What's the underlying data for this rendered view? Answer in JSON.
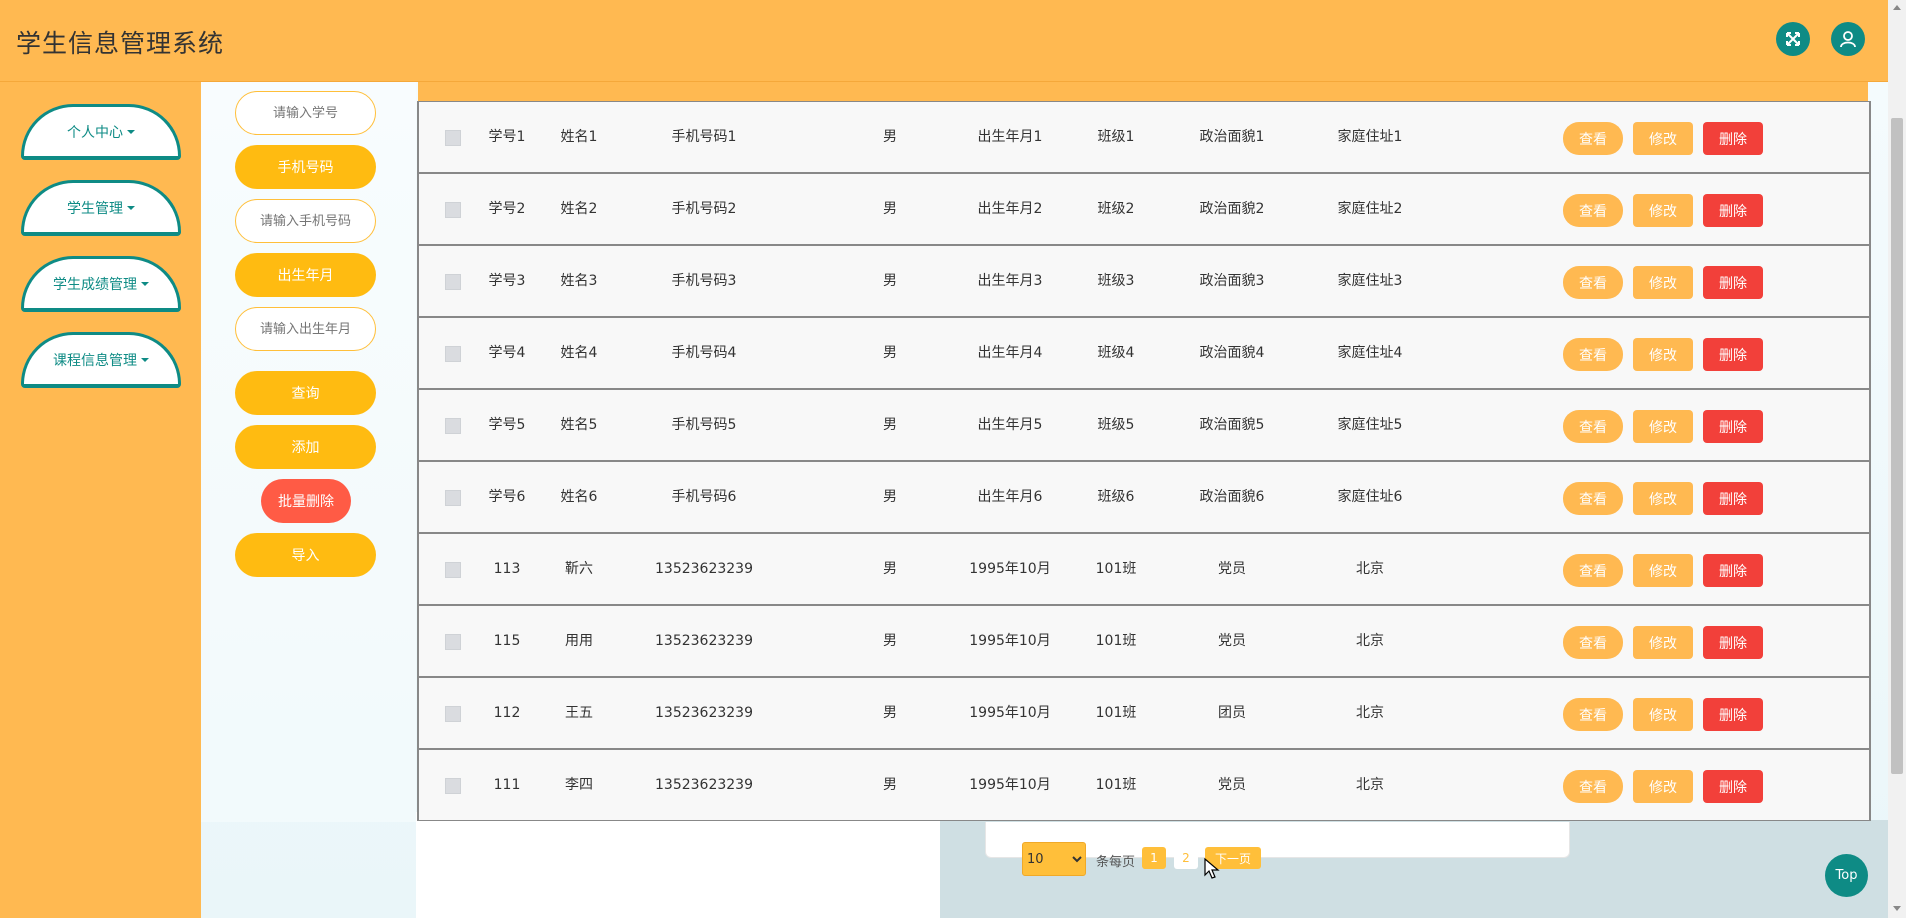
{
  "header": {
    "title": "学生信息管理系统"
  },
  "sidebar": {
    "items": [
      {
        "label": "个人中心"
      },
      {
        "label": "学生管理"
      },
      {
        "label": "学生成绩管理"
      },
      {
        "label": "课程信息管理"
      }
    ]
  },
  "filters": {
    "xuehao_placeholder": "请输入学号",
    "phone_label": "手机号码",
    "phone_placeholder": "请输入手机号码",
    "birth_label": "出生年月",
    "birth_placeholder": "请输入出生年月",
    "query_label": "查询",
    "add_label": "添加",
    "batch_delete_label": "批量删除",
    "import_label": "导入"
  },
  "table": {
    "actions": {
      "view": "查看",
      "edit": "修改",
      "delete": "删除"
    },
    "rows": [
      {
        "xuehao": "学号1",
        "name": "姓名1",
        "phone": "手机号码1",
        "gender": "男",
        "birth": "出生年月1",
        "class": "班级1",
        "politics": "政治面貌1",
        "address": "家庭住址1"
      },
      {
        "xuehao": "学号2",
        "name": "姓名2",
        "phone": "手机号码2",
        "gender": "男",
        "birth": "出生年月2",
        "class": "班级2",
        "politics": "政治面貌2",
        "address": "家庭住址2"
      },
      {
        "xuehao": "学号3",
        "name": "姓名3",
        "phone": "手机号码3",
        "gender": "男",
        "birth": "出生年月3",
        "class": "班级3",
        "politics": "政治面貌3",
        "address": "家庭住址3"
      },
      {
        "xuehao": "学号4",
        "name": "姓名4",
        "phone": "手机号码4",
        "gender": "男",
        "birth": "出生年月4",
        "class": "班级4",
        "politics": "政治面貌4",
        "address": "家庭住址4"
      },
      {
        "xuehao": "学号5",
        "name": "姓名5",
        "phone": "手机号码5",
        "gender": "男",
        "birth": "出生年月5",
        "class": "班级5",
        "politics": "政治面貌5",
        "address": "家庭住址5"
      },
      {
        "xuehao": "学号6",
        "name": "姓名6",
        "phone": "手机号码6",
        "gender": "男",
        "birth": "出生年月6",
        "class": "班级6",
        "politics": "政治面貌6",
        "address": "家庭住址6"
      },
      {
        "xuehao": "113",
        "name": "靳六",
        "phone": "13523623239",
        "gender": "男",
        "birth": "1995年10月",
        "class": "101班",
        "politics": "党员",
        "address": "北京"
      },
      {
        "xuehao": "115",
        "name": "用用",
        "phone": "13523623239",
        "gender": "男",
        "birth": "1995年10月",
        "class": "101班",
        "politics": "党员",
        "address": "北京"
      },
      {
        "xuehao": "112",
        "name": "王五",
        "phone": "13523623239",
        "gender": "男",
        "birth": "1995年10月",
        "class": "101班",
        "politics": "团员",
        "address": "北京"
      },
      {
        "xuehao": "111",
        "name": "李四",
        "phone": "13523623239",
        "gender": "男",
        "birth": "1995年10月",
        "class": "101班",
        "politics": "党员",
        "address": "北京"
      }
    ]
  },
  "pagination": {
    "page_size": "10",
    "per_page_label": "条每页",
    "pages": [
      "1",
      "2"
    ],
    "current_page": "1",
    "next_label": "下一页"
  },
  "back_to_top": {
    "label": "Top"
  },
  "colors": {
    "header_bg": "#ffb951",
    "teal": "#0e8b85",
    "button_yellow": "#ffbb11",
    "delete_red": "#f2403a",
    "batch_red": "#ff5b45"
  },
  "icons": {
    "fullscreen": "fullscreen-icon",
    "user": "user-icon",
    "caret": "caret-down-icon",
    "cursor": "mouse-pointer-icon"
  }
}
